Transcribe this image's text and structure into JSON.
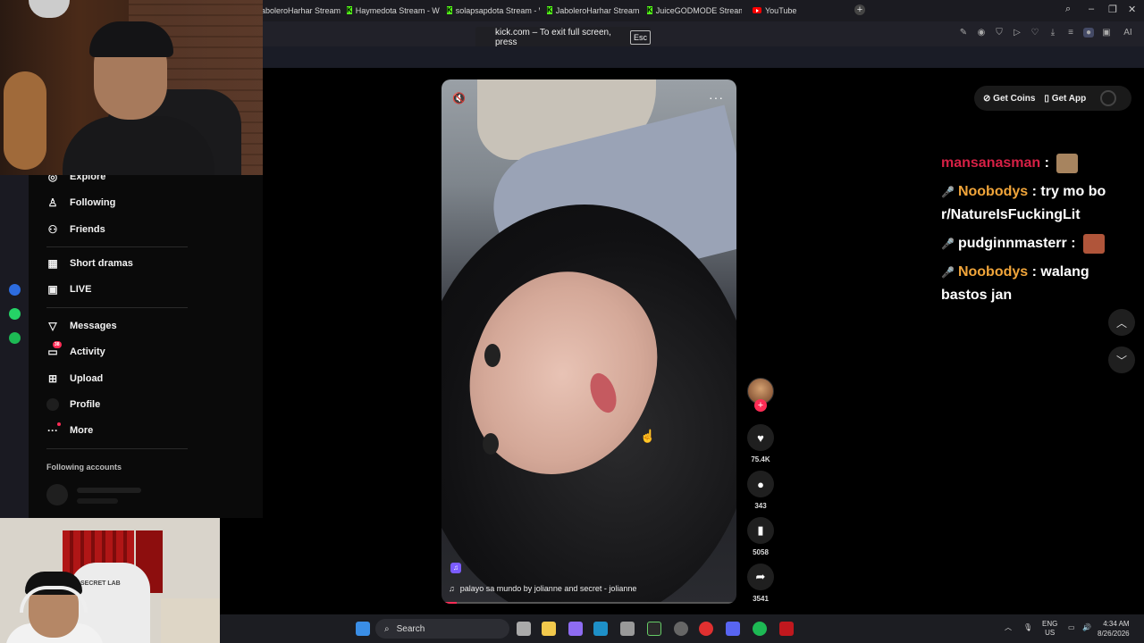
{
  "browser": {
    "tabs": [
      {
        "label": "aboleroHarhar Stream - K",
        "icon": "kick-icon"
      },
      {
        "label": "Haymedota Stream - Wat",
        "icon": "kick-icon"
      },
      {
        "label": "solapsapdota Stream - W",
        "icon": "kick-icon"
      },
      {
        "label": "JaboleroHarhar Stream - K",
        "icon": "kick-icon"
      },
      {
        "label": "JuiceGODMODE Stream -",
        "icon": "kick-icon"
      },
      {
        "label": "YouTube",
        "icon": "youtube-icon"
      }
    ],
    "fullscreen_notice": "kick.com – To exit full screen, press",
    "fullscreen_key": "Esc",
    "toolbar_ai": "AI"
  },
  "sidebar": {
    "items": [
      {
        "label": "Explore",
        "icon": "compass-icon"
      },
      {
        "label": "Following",
        "icon": "user-follow-icon"
      },
      {
        "label": "Friends",
        "icon": "friends-icon"
      },
      {
        "label": "Short dramas",
        "icon": "film-icon"
      },
      {
        "label": "LIVE",
        "icon": "live-icon"
      },
      {
        "label": "Messages",
        "icon": "send-icon"
      },
      {
        "label": "Activity",
        "icon": "activity-icon",
        "badge": "38"
      },
      {
        "label": "Upload",
        "icon": "upload-icon"
      },
      {
        "label": "Profile",
        "icon": "profile-avatar"
      },
      {
        "label": "More",
        "icon": "more-icon"
      }
    ],
    "following_title": "Following accounts"
  },
  "video": {
    "caption": "palayo sa mundo by jolianne and secret - jolianne",
    "progress": 0.05
  },
  "actions": {
    "likes": "75.4K",
    "comments": "343",
    "saves": "5058",
    "shares": "3541"
  },
  "top_right": {
    "get_coins": "Get Coins",
    "get_app": "Get App"
  },
  "chat": [
    {
      "user": "mansanasman",
      "color": "#d62045",
      "message": "",
      "emote": true
    },
    {
      "user": "Noobodys",
      "color": "#f1a53a",
      "message": "try mo bo r/NatureIsFuckingLit",
      "emote": false
    },
    {
      "user": "pudginnmasterr",
      "color": "#ffffff",
      "message": "",
      "emote": true
    },
    {
      "user": "Noobodys",
      "color": "#f1a53a",
      "message": "walang bastos jan",
      "emote": false
    }
  ],
  "taskbar": {
    "search": "Search",
    "lang_top": "ENG",
    "lang_bottom": "US",
    "time": "4:34 AM",
    "date": "8/26/2026"
  }
}
